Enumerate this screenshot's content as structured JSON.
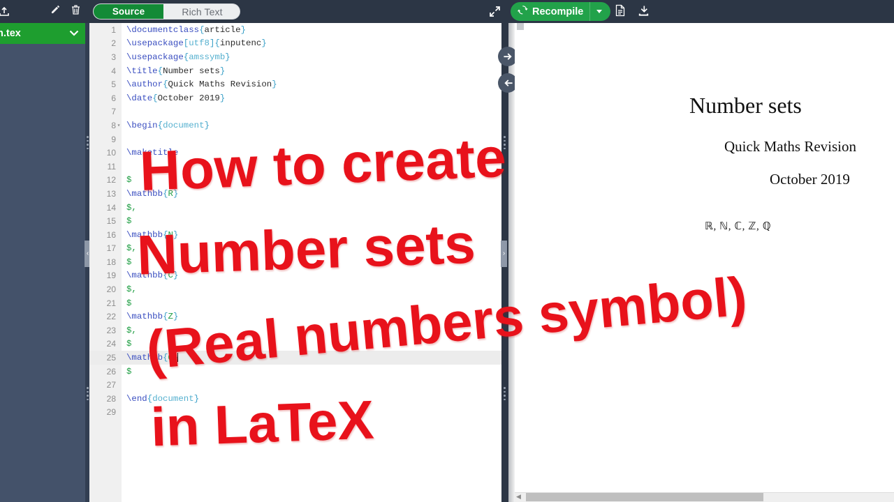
{
  "topbar": {
    "upload_icon": "upload-icon",
    "edit_icon": "pencil-icon",
    "delete_icon": "trash-icon",
    "expand_icon": "expand-arrows-icon",
    "toggle": {
      "source_label": "Source",
      "rich_text_label": "Rich Text",
      "active": "Source"
    },
    "recompile": {
      "label": "Recompile",
      "icon": "refresh-icon",
      "caret": "chevron-down-icon"
    },
    "pdf_file_icon": "document-icon",
    "download_icon": "download-icon"
  },
  "sidebar": {
    "file_name": "in.tex",
    "chevron": "chevron-down-icon",
    "collapse_chevron": "‹"
  },
  "divider": {
    "expand_right_icon": "arrow-right-icon",
    "collapse_left_icon": "arrow-left-icon",
    "handle_chevron": "›"
  },
  "editor": {
    "lines": [
      {
        "n": "1",
        "fold": "",
        "tokens": [
          {
            "t": "\\documentclass",
            "c": "k-cmd"
          },
          {
            "t": "{",
            "c": "k-brace"
          },
          {
            "t": "article",
            "c": "k-plain"
          },
          {
            "t": "}",
            "c": "k-brace"
          }
        ]
      },
      {
        "n": "2",
        "fold": "",
        "tokens": [
          {
            "t": "\\usepackage",
            "c": "k-cmd"
          },
          {
            "t": "[",
            "c": "k-brace"
          },
          {
            "t": "utf8",
            "c": "k-opt"
          },
          {
            "t": "]",
            "c": "k-brace"
          },
          {
            "t": "{",
            "c": "k-brace"
          },
          {
            "t": "inputenc",
            "c": "k-plain"
          },
          {
            "t": "}",
            "c": "k-brace"
          }
        ]
      },
      {
        "n": "3",
        "fold": "",
        "tokens": [
          {
            "t": "\\usepackage",
            "c": "k-cmd"
          },
          {
            "t": "{",
            "c": "k-brace"
          },
          {
            "t": "amssymb",
            "c": "k-opt"
          },
          {
            "t": "}",
            "c": "k-brace"
          }
        ]
      },
      {
        "n": "4",
        "fold": "",
        "tokens": [
          {
            "t": "\\title",
            "c": "k-cmd"
          },
          {
            "t": "{",
            "c": "k-brace"
          },
          {
            "t": "Number sets",
            "c": "k-plain"
          },
          {
            "t": "}",
            "c": "k-brace"
          }
        ]
      },
      {
        "n": "5",
        "fold": "",
        "tokens": [
          {
            "t": "\\author",
            "c": "k-cmd"
          },
          {
            "t": "{",
            "c": "k-brace"
          },
          {
            "t": "Quick Maths Revision",
            "c": "k-plain"
          },
          {
            "t": "}",
            "c": "k-brace"
          }
        ]
      },
      {
        "n": "6",
        "fold": "",
        "tokens": [
          {
            "t": "\\date",
            "c": "k-cmd"
          },
          {
            "t": "{",
            "c": "k-brace"
          },
          {
            "t": "October 2019",
            "c": "k-plain"
          },
          {
            "t": "}",
            "c": "k-brace"
          }
        ]
      },
      {
        "n": "7",
        "fold": "",
        "tokens": []
      },
      {
        "n": "8",
        "fold": "▾",
        "tokens": [
          {
            "t": "\\begin",
            "c": "k-cmd"
          },
          {
            "t": "{",
            "c": "k-brace"
          },
          {
            "t": "document",
            "c": "k-opt"
          },
          {
            "t": "}",
            "c": "k-brace"
          }
        ]
      },
      {
        "n": "9",
        "fold": "",
        "tokens": []
      },
      {
        "n": "10",
        "fold": "",
        "tokens": [
          {
            "t": "\\maketitle",
            "c": "k-cmd"
          }
        ]
      },
      {
        "n": "11",
        "fold": "",
        "tokens": []
      },
      {
        "n": "12",
        "fold": "",
        "tokens": [
          {
            "t": "$",
            "c": "k-dollar"
          }
        ]
      },
      {
        "n": "13",
        "fold": "",
        "tokens": [
          {
            "t": "\\mathbb",
            "c": "k-cmd"
          },
          {
            "t": "{",
            "c": "k-brace"
          },
          {
            "t": "R",
            "c": "k-arg"
          },
          {
            "t": "}",
            "c": "k-brace"
          }
        ]
      },
      {
        "n": "14",
        "fold": "",
        "tokens": [
          {
            "t": "$,",
            "c": "k-dollar"
          }
        ]
      },
      {
        "n": "15",
        "fold": "",
        "tokens": [
          {
            "t": "$",
            "c": "k-dollar"
          }
        ]
      },
      {
        "n": "16",
        "fold": "",
        "tokens": [
          {
            "t": "\\mathbb",
            "c": "k-cmd"
          },
          {
            "t": "{",
            "c": "k-brace"
          },
          {
            "t": "N",
            "c": "k-arg"
          },
          {
            "t": "}",
            "c": "k-brace"
          }
        ]
      },
      {
        "n": "17",
        "fold": "",
        "tokens": [
          {
            "t": "$,",
            "c": "k-dollar"
          }
        ]
      },
      {
        "n": "18",
        "fold": "",
        "tokens": [
          {
            "t": "$",
            "c": "k-dollar"
          }
        ]
      },
      {
        "n": "19",
        "fold": "",
        "tokens": [
          {
            "t": "\\mathbb",
            "c": "k-cmd"
          },
          {
            "t": "{",
            "c": "k-brace"
          },
          {
            "t": "C",
            "c": "k-arg"
          },
          {
            "t": "}",
            "c": "k-brace"
          }
        ]
      },
      {
        "n": "20",
        "fold": "",
        "tokens": [
          {
            "t": "$,",
            "c": "k-dollar"
          }
        ]
      },
      {
        "n": "21",
        "fold": "",
        "tokens": [
          {
            "t": "$",
            "c": "k-dollar"
          }
        ]
      },
      {
        "n": "22",
        "fold": "",
        "tokens": [
          {
            "t": "\\mathbb",
            "c": "k-cmd"
          },
          {
            "t": "{",
            "c": "k-brace"
          },
          {
            "t": "Z",
            "c": "k-arg"
          },
          {
            "t": "}",
            "c": "k-brace"
          }
        ]
      },
      {
        "n": "23",
        "fold": "",
        "tokens": [
          {
            "t": "$,",
            "c": "k-dollar"
          }
        ]
      },
      {
        "n": "24",
        "fold": "",
        "tokens": [
          {
            "t": "$",
            "c": "k-dollar"
          }
        ]
      },
      {
        "n": "25",
        "fold": "",
        "active": true,
        "cursor": true,
        "tokens": [
          {
            "t": "\\mathbb",
            "c": "k-cmd"
          },
          {
            "t": "{",
            "c": "k-brace"
          },
          {
            "t": "Q",
            "c": "k-arg"
          },
          {
            "t": "}",
            "c": "k-brace"
          }
        ]
      },
      {
        "n": "26",
        "fold": "",
        "tokens": [
          {
            "t": "$",
            "c": "k-dollar"
          }
        ]
      },
      {
        "n": "27",
        "fold": "",
        "tokens": []
      },
      {
        "n": "28",
        "fold": "",
        "tokens": [
          {
            "t": "\\end",
            "c": "k-cmd"
          },
          {
            "t": "{",
            "c": "k-brace"
          },
          {
            "t": "document",
            "c": "k-opt"
          },
          {
            "t": "}",
            "c": "k-brace"
          }
        ]
      },
      {
        "n": "29",
        "fold": "",
        "tokens": []
      }
    ]
  },
  "preview": {
    "title": "Number sets",
    "author": "Quick Maths Revision",
    "date": "October 2019",
    "body": "ℝ, ℕ, ℂ, ℤ, ℚ",
    "scroll_left_arrow": "◀"
  },
  "overlay": {
    "line1": "How to create",
    "line2": "Number sets",
    "line3": "(Real numbers symbol)",
    "line4": "in LaTeX",
    "color": "#e8121b"
  }
}
